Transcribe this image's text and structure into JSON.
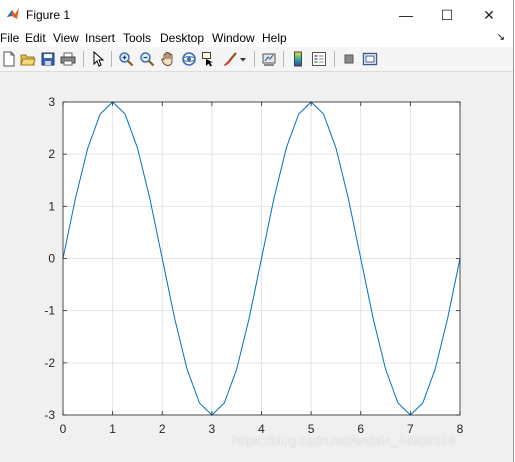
{
  "window": {
    "title": "Figure 1",
    "minimize_glyph": "—",
    "maximize_glyph": "☐",
    "close_glyph": "✕"
  },
  "menu": {
    "items": [
      "File",
      "Edit",
      "View",
      "Insert",
      "Tools",
      "Desktop",
      "Window",
      "Help"
    ],
    "dock_glyph": "↘"
  },
  "toolbar": {
    "icons": [
      "new-figure-icon",
      "open-file-icon",
      "save-icon",
      "print-icon",
      "pointer-icon",
      "zoom-in-icon",
      "zoom-out-icon",
      "pan-icon",
      "rotate-3d-icon",
      "data-cursor-icon",
      "brush-icon",
      "brush-dropdown-icon",
      "link-plot-icon",
      "colorbar-icon",
      "legend-icon",
      "hide-plot-tools-icon",
      "show-plot-tools-icon"
    ]
  },
  "chart_data": {
    "type": "line",
    "title": "",
    "xlabel": "",
    "ylabel": "",
    "xlim": [
      0,
      8
    ],
    "ylim": [
      -3,
      3
    ],
    "xticks": [
      "0",
      "1",
      "2",
      "3",
      "4",
      "5",
      "6",
      "7",
      "8"
    ],
    "yticks": [
      "-3",
      "-2",
      "-1",
      "0",
      "1",
      "2",
      "3"
    ],
    "grid": true,
    "line_color": "#0072bd",
    "series": [
      {
        "x": [
          0,
          0.25,
          0.5,
          0.75,
          1,
          1.25,
          1.5,
          1.75,
          2,
          2.25,
          2.5,
          2.75,
          3,
          3.25,
          3.5,
          3.75,
          4,
          4.25,
          4.5,
          4.75,
          5,
          5.25,
          5.5,
          5.75,
          6,
          6.25,
          6.5,
          6.75,
          7,
          7.25,
          7.5,
          7.75,
          8
        ],
        "values": [
          0,
          1.15,
          2.12,
          2.77,
          3,
          2.77,
          2.12,
          1.15,
          0,
          -1.15,
          -2.12,
          -2.77,
          -3,
          -2.77,
          -2.12,
          -1.15,
          0,
          1.15,
          2.12,
          2.77,
          3,
          2.77,
          2.12,
          1.15,
          0,
          -1.15,
          -2.12,
          -2.77,
          -3,
          -2.77,
          -2.12,
          -1.15,
          0
        ]
      }
    ]
  },
  "watermark": "https://blog.csdn.net/weixin_44908159"
}
